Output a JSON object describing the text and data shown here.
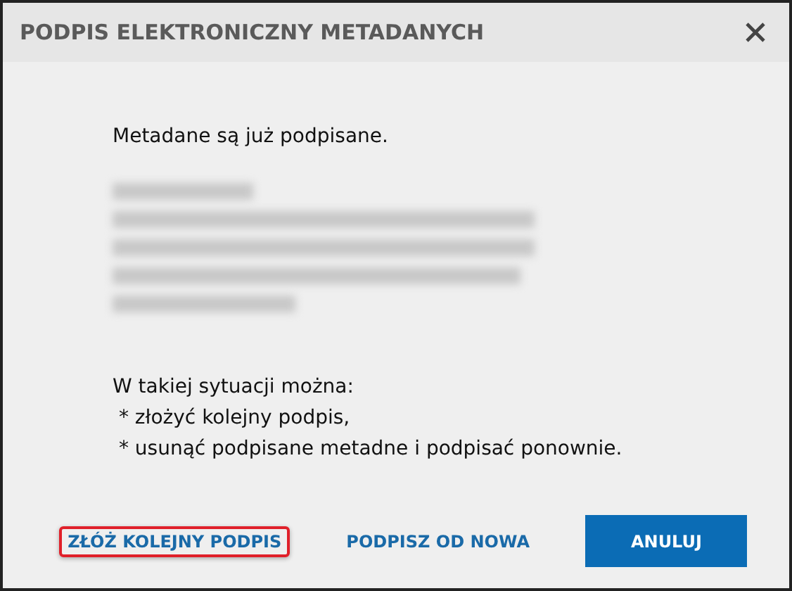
{
  "dialog": {
    "title": "PODPIS ELEKTRONICZNY METADANYCH",
    "message": "Metadane są już podpisane.",
    "options_intro": "W takiej sytuacji można:",
    "options": [
      " * złożyć kolejny podpis,",
      " * usunąć podpisane metadne i podpisać ponownie."
    ],
    "buttons": [
      {
        "label": "ZŁÓŻ KOLEJNY PODPIS",
        "kind": "link",
        "focused": true
      },
      {
        "label": "PODPISZ OD NOWA",
        "kind": "link",
        "focused": false
      },
      {
        "label": "ANULUJ",
        "kind": "primary",
        "focused": false
      }
    ]
  }
}
